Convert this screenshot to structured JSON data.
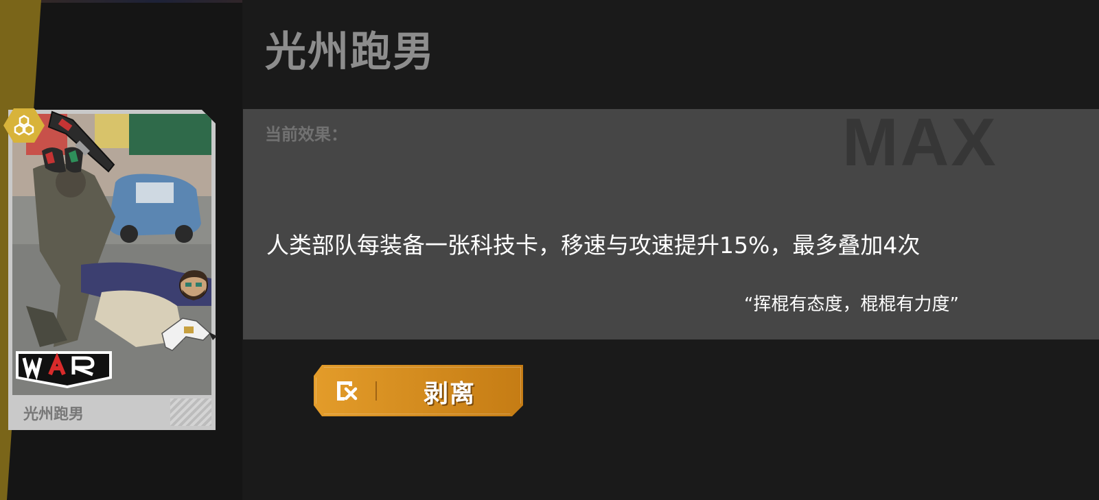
{
  "card": {
    "title": "光州跑男",
    "name_label": "光州跑男",
    "logo_text": "WAR"
  },
  "effect": {
    "label": "当前效果：",
    "level": "MAX",
    "description": "人类部队每装备一张科技卡，移速与攻速提升15%，最多叠加4次",
    "quote": "“挥棍有态度，棍棍有力度”"
  },
  "actions": {
    "strip_label": "剥离"
  },
  "colors": {
    "gold_band": "#7a6519",
    "button_orange": "#e39c2a",
    "effect_panel": "#464646",
    "background": "#151515"
  },
  "icons": {
    "badge": "hexagon-tier-icon",
    "weapon": "gun-icon",
    "avatar": "bearded-face-icon",
    "figure": "white-figure-icon",
    "strip": "strip-card-icon"
  }
}
